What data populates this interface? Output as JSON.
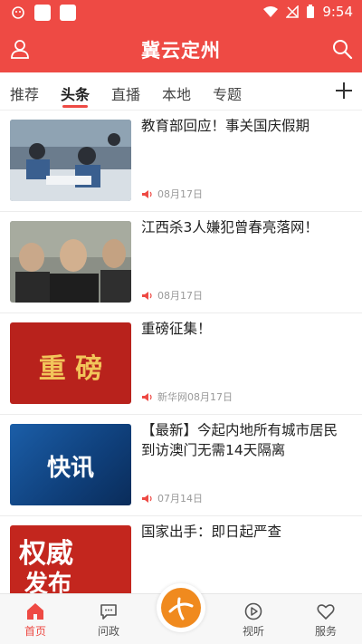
{
  "status_bar": {
    "time": "9:54"
  },
  "header": {
    "title": "冀云定州"
  },
  "tabs": [
    {
      "label": "推荐"
    },
    {
      "label": "头条"
    },
    {
      "label": "直播"
    },
    {
      "label": "本地"
    },
    {
      "label": "专题"
    }
  ],
  "active_tab": "头条",
  "feed": [
    {
      "headline": "教育部回应！事关国庆假期",
      "date": "08月17日",
      "thumb_text": ""
    },
    {
      "headline": "江西杀3人嫌犯曾春亮落网！",
      "date": "08月17日",
      "thumb_text": ""
    },
    {
      "headline": "重磅征集！",
      "date": "新华网08月17日",
      "thumb_text": "重 磅"
    },
    {
      "headline": "【最新】今起内地所有城市居民到访澳门无需14天隔离",
      "date": "07月14日",
      "thumb_text": "快讯"
    },
    {
      "headline": "国家出手：即日起严查",
      "date": "",
      "thumb_text_1": "权威",
      "thumb_text_2": "发布"
    }
  ],
  "bottom_nav": [
    {
      "label": "首页",
      "icon": "home-icon"
    },
    {
      "label": "问政",
      "icon": "chat-icon"
    },
    {
      "label": "视听",
      "icon": "play-icon"
    },
    {
      "label": "服务",
      "icon": "heart-icon"
    }
  ],
  "colors": {
    "accent": "#ee4a44",
    "center_button": "#f08a1e"
  }
}
